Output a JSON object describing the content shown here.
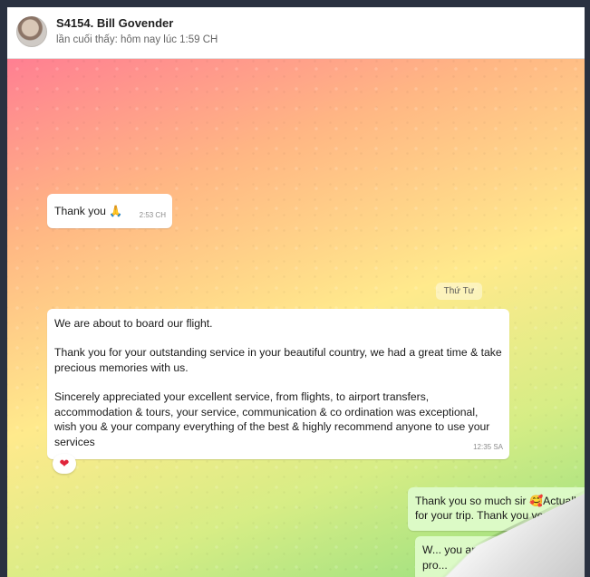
{
  "header": {
    "name": "S4154. Bill Govender",
    "status": "lần cuối thấy: hôm nay lúc 1:59 CH"
  },
  "messages": {
    "in1": {
      "text": "Thank you 🙏",
      "time": "2:53 CH"
    },
    "day_chip": "Thứ Tư",
    "in2": {
      "p1": "We are about to board our flight.",
      "p2": "Thank you for your outstanding service in your beautiful country, we had a great time & take precious memories with us.",
      "p3": "Sincerely appreciated your excellent service, from flights, to airport transfers, accommodation & tours, your service, communication  & co ordination was exceptional, wish you & your company everything of the best & highly recommend anyone to use your services",
      "time": "12:35 SA",
      "reaction": "❤"
    },
    "out1": {
      "line1": "Thank you so much sir 🥰Actually,",
      "line2": "for your trip. Thank you very much"
    },
    "out2": {
      "line1": "W... you and all",
      "line2": "pro..."
    }
  },
  "colors": {
    "incoming_bubble": "#ffffff",
    "outgoing_bubble": "#dcfac6",
    "reaction_heart": "#e0243b"
  },
  "icons": {
    "avatar": "contact-avatar",
    "reaction": "heart-reaction-icon"
  }
}
